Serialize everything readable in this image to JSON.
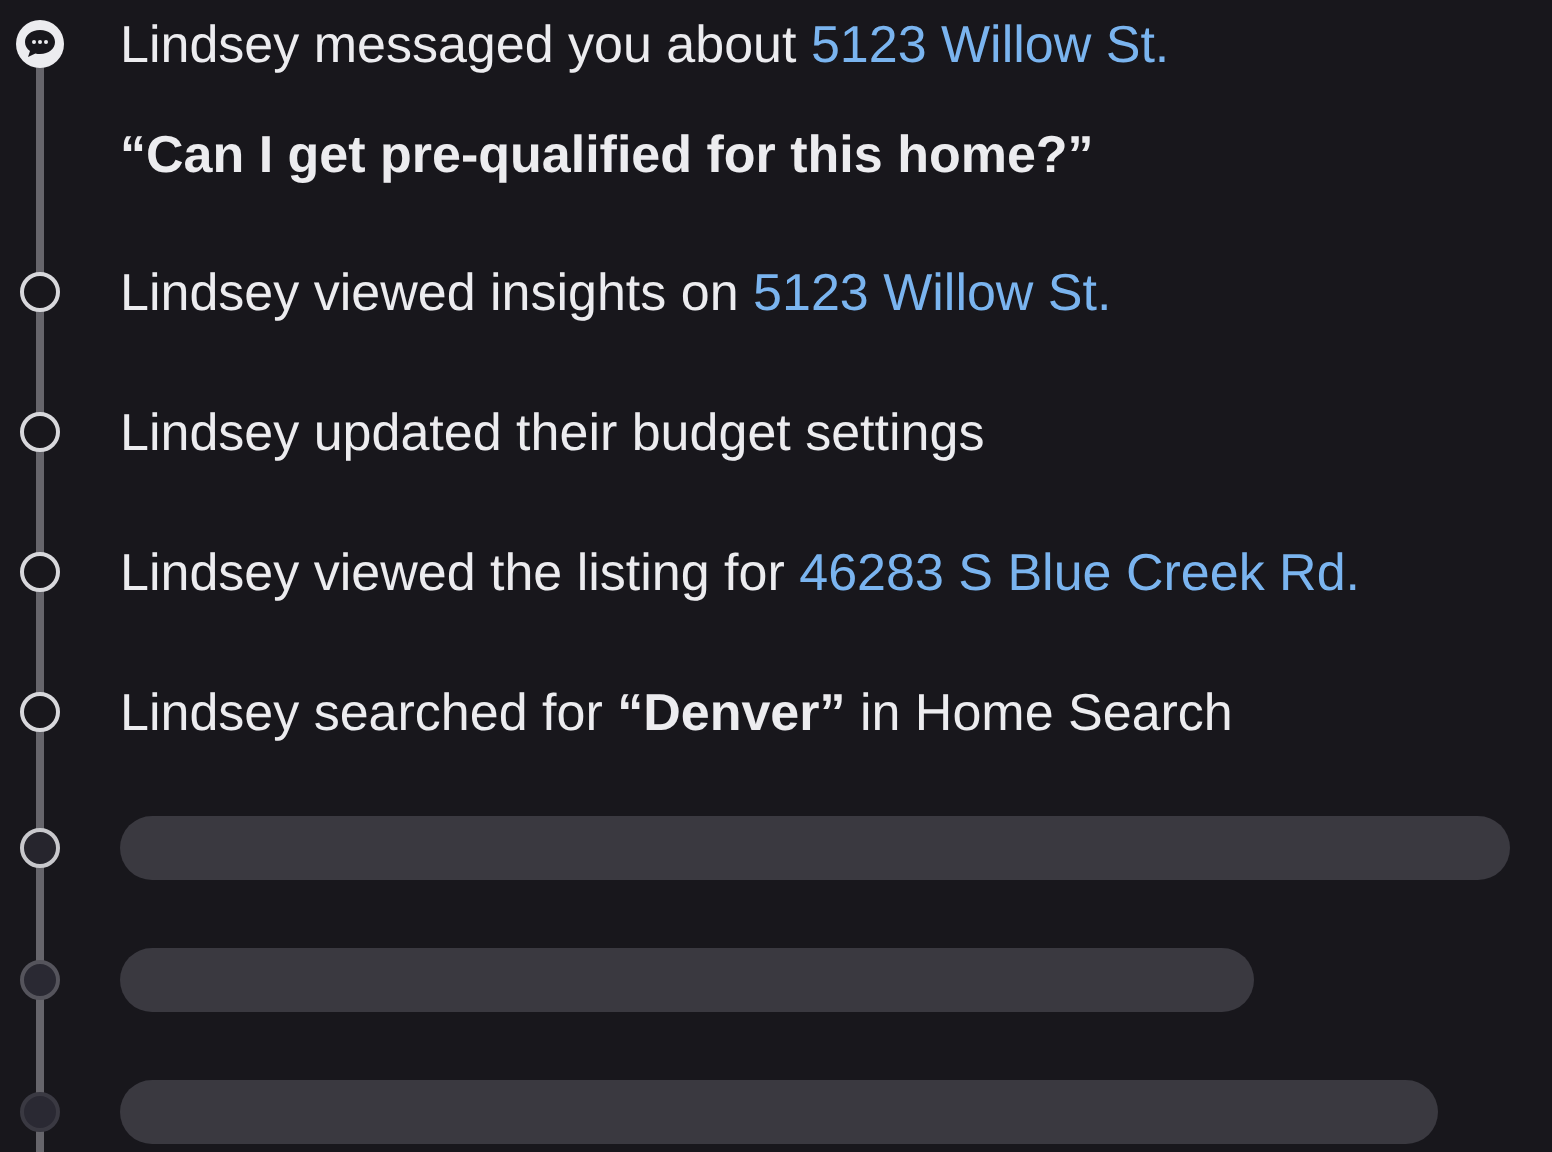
{
  "timeline": [
    {
      "kind": "message",
      "text": "Lindsey messaged you about ",
      "link": "5123 Willow St.",
      "quote": "“Can I get pre-qualified for this home?”"
    },
    {
      "kind": "event",
      "text": "Lindsey viewed insights on ",
      "link": "5123 Willow St."
    },
    {
      "kind": "event",
      "text": "Lindsey updated their budget settings"
    },
    {
      "kind": "event",
      "text": "Lindsey viewed the listing for ",
      "link": "46283 S Blue Creek Rd."
    },
    {
      "kind": "event",
      "text": "Lindsey searched for **“Denver”** in Home Search"
    },
    {
      "kind": "placeholder"
    },
    {
      "kind": "placeholder"
    },
    {
      "kind": "placeholder"
    }
  ]
}
